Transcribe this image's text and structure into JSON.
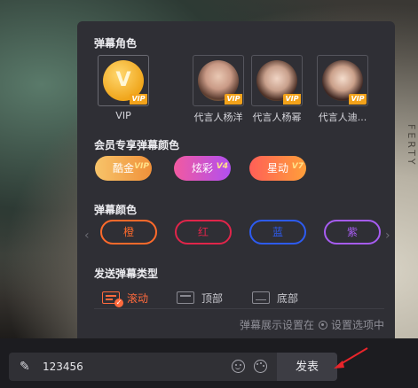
{
  "sections": {
    "role_title": "弹幕角色",
    "member_color_title": "会员专享弹幕颜色",
    "color_title": "弹幕颜色",
    "type_title": "发送弹幕类型"
  },
  "roles": [
    {
      "name": "VIP",
      "badge": "VIP",
      "icon": "vip-crown-icon"
    },
    {
      "name": "代言人杨洋",
      "badge": "VIP",
      "icon": "avatar-yangyang"
    },
    {
      "name": "代言人杨幂",
      "badge": "VIP",
      "icon": "avatar-yangmi"
    },
    {
      "name": "代言人迪...",
      "badge": "VIP",
      "icon": "avatar-dilireba"
    }
  ],
  "member_colors": [
    {
      "label": "酷金",
      "tag": "VIP"
    },
    {
      "label": "炫彩",
      "tag": "V4"
    },
    {
      "label": "星动",
      "tag": "V7"
    }
  ],
  "colors": [
    {
      "label": "橙",
      "color": "#ff6a2b"
    },
    {
      "label": "红",
      "color": "#e0254a"
    },
    {
      "label": "蓝",
      "color": "#2d5bf0"
    },
    {
      "label": "紫",
      "color": "#a65cf0"
    }
  ],
  "nav": {
    "prev": "‹",
    "next": "›"
  },
  "types": [
    {
      "label": "滚动",
      "active": true
    },
    {
      "label": "顶部",
      "active": false
    },
    {
      "label": "底部",
      "active": false
    }
  ],
  "settings_note": {
    "prefix": "弹幕展示设置在",
    "suffix": "设置选项中"
  },
  "input": {
    "value": "123456"
  },
  "send_button": "发表",
  "accent_color": "#ff6a3d",
  "video_edge_text": "FERTY"
}
